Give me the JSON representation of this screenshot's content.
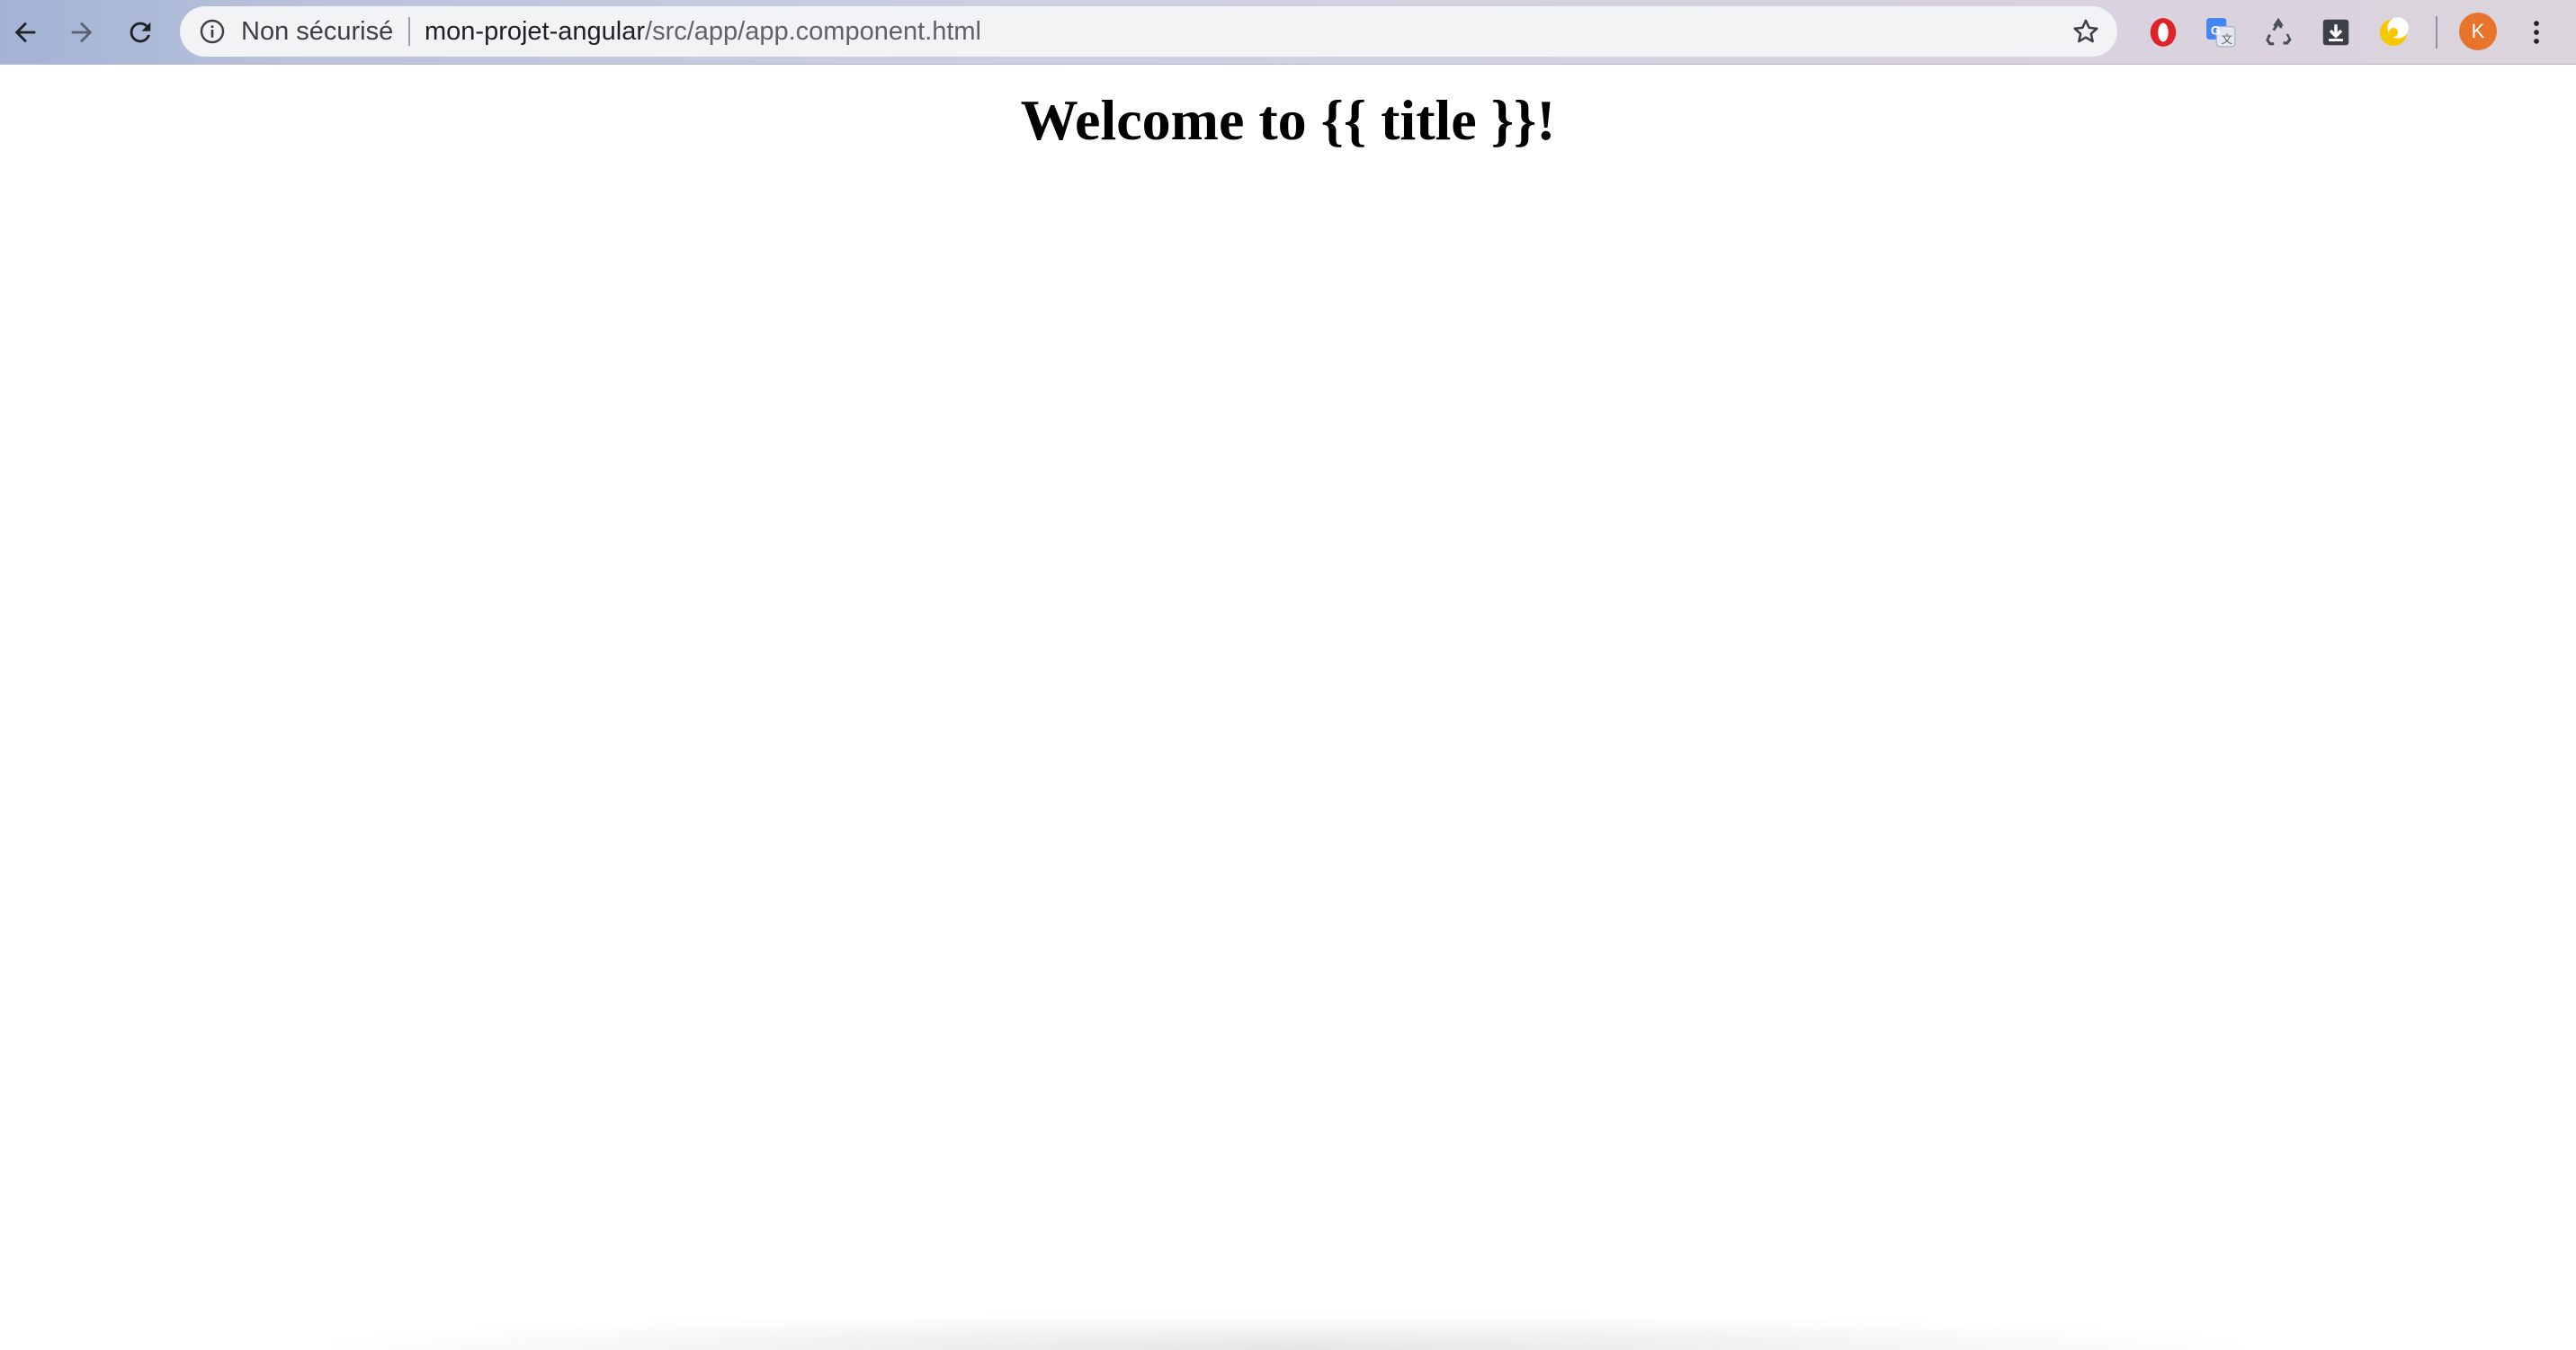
{
  "browser": {
    "security_label": "Non sécurisé",
    "url_host": "mon-projet-angular",
    "url_path": "/src/app/app.component.html",
    "profile_initial": "K",
    "colors": {
      "avatar": "#e8742c",
      "omnibox": "#f1f3f4"
    },
    "icons": {
      "back": "arrow-left",
      "forward": "arrow-right",
      "reload": "reload",
      "info": "info-circle",
      "bookmark": "star-outline",
      "extensions": [
        "opera-icon",
        "google-translate-icon",
        "recycle-icon",
        "download-box-icon",
        "night-mode-icon"
      ],
      "menu": "vertical-dots"
    }
  },
  "page": {
    "heading": "Welcome to {{ title }}!"
  }
}
